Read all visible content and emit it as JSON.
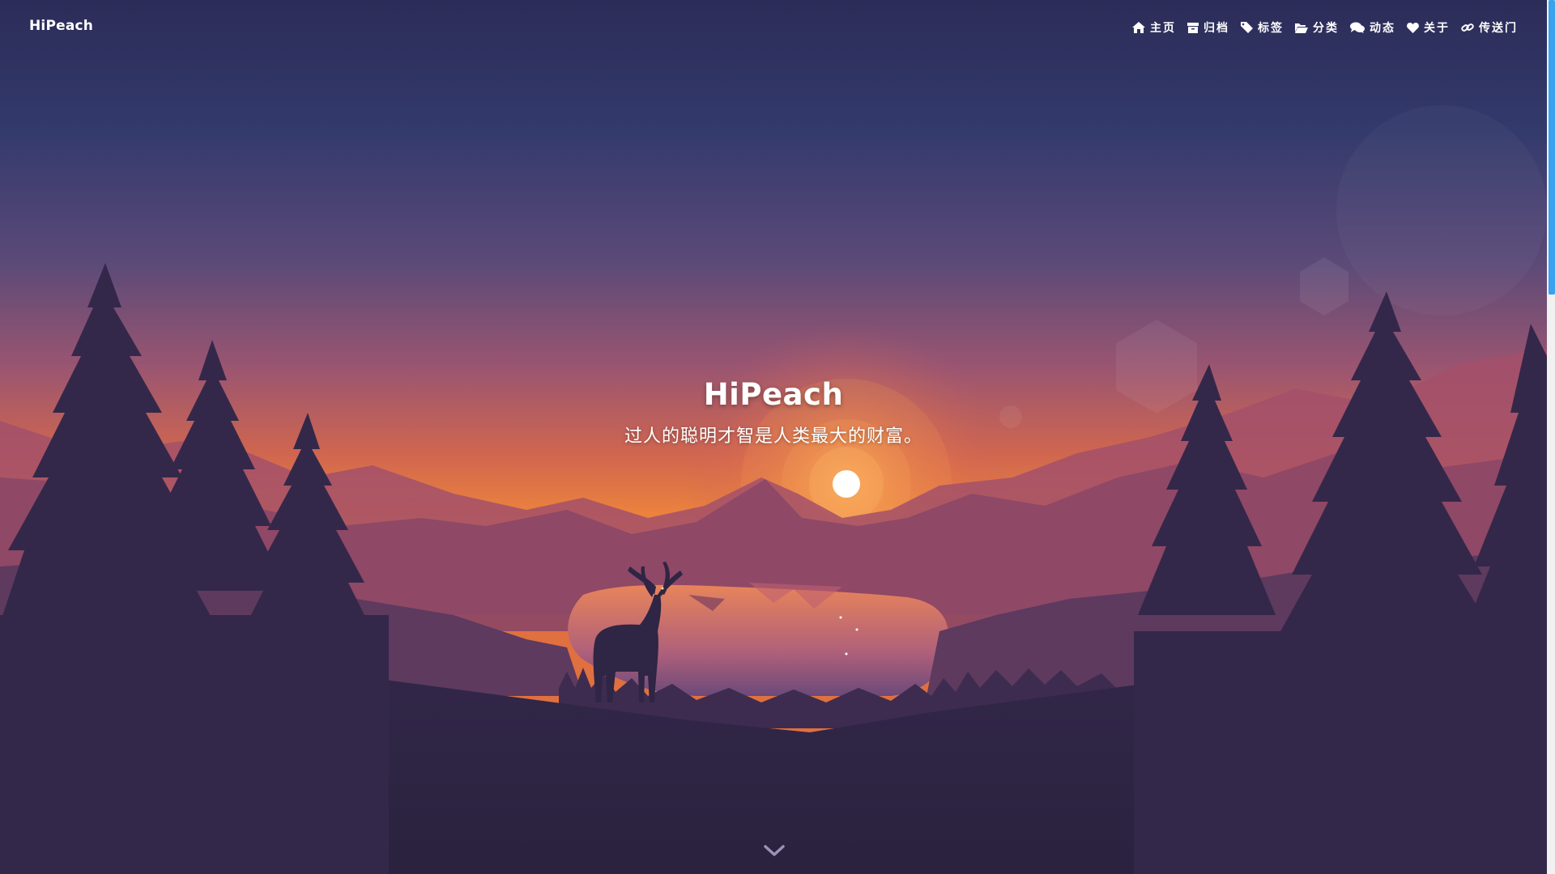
{
  "site": {
    "brand": "HiPeach"
  },
  "nav": {
    "items": [
      {
        "label": "主页",
        "icon": "home-icon"
      },
      {
        "label": "归档",
        "icon": "archive-icon"
      },
      {
        "label": "标签",
        "icon": "tag-icon"
      },
      {
        "label": "分类",
        "icon": "folder-open-icon"
      },
      {
        "label": "动态",
        "icon": "comments-icon"
      },
      {
        "label": "关于",
        "icon": "heart-icon"
      },
      {
        "label": "传送门",
        "icon": "link-icon"
      }
    ]
  },
  "hero": {
    "title": "HiPeach",
    "subtitle": "过人的聪明才智是人类最大的财富。"
  },
  "scroll_down": {
    "icon": "chevron-down-icon"
  },
  "colors": {
    "sky_top": "#2d2f5e",
    "sky_mid": "#8a4f6e",
    "sky_horizon": "#f08a3c",
    "silhouette": "#2e2442",
    "scrollbar_thumb": "#3aa3f0"
  }
}
